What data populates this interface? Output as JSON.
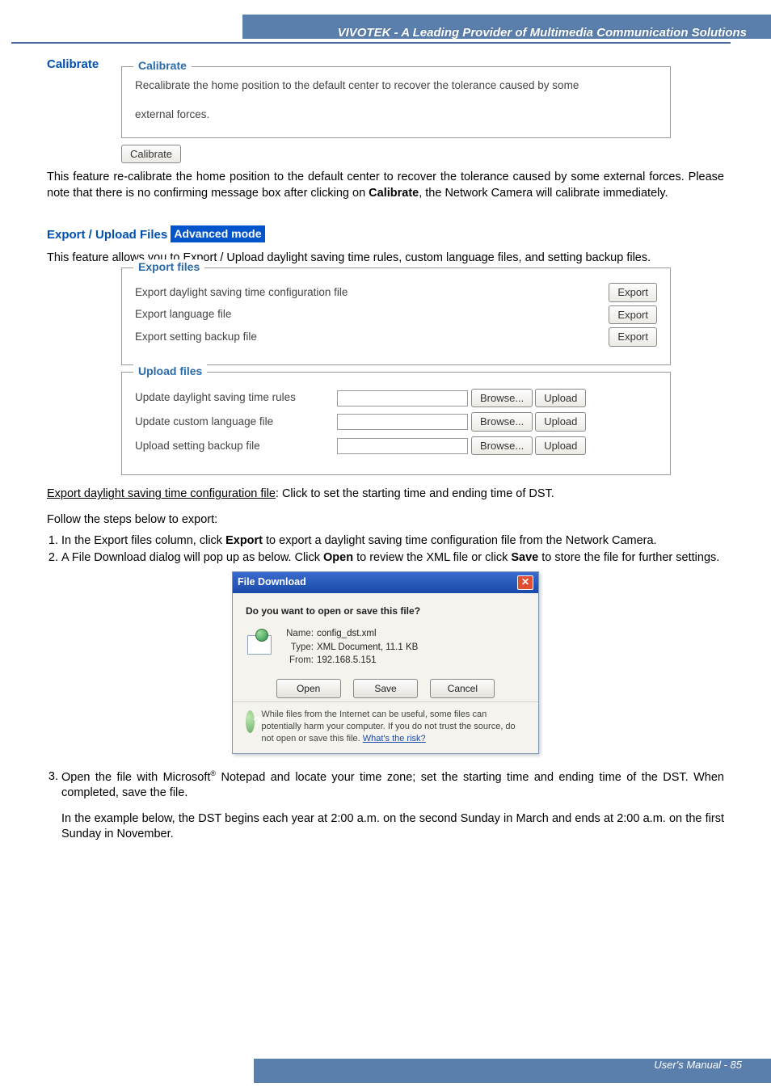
{
  "header": {
    "brand_line": "VIVOTEK - A Leading Provider of Multimedia Communication Solutions"
  },
  "calibrate": {
    "title": "Calibrate",
    "fieldset_legend": "Calibrate",
    "fieldset_line1": "Recalibrate the home position to the default center to recover the tolerance caused by some",
    "fieldset_line2": "external forces.",
    "button": "Calibrate",
    "body": "This feature re-calibrate the home position to the default center to recover the tolerance caused by some external forces. Please note that there is no confirming message box after clicking on Calibrate, the Network Camera will calibrate immediately.",
    "body_prefix": "This feature re-calibrate the home position to the default center to recover the tolerance caused by some external forces. Please note that there is no confirming message box after clicking on ",
    "body_bold": "Calibrate",
    "body_suffix": ", the Network Camera will calibrate immediately."
  },
  "export_upload": {
    "title": "Export / Upload Files",
    "badge": "Advanced mode",
    "intro": "This feature allows you to Export / Upload daylight saving time rules, custom language files, and setting backup files.",
    "export_legend": "Export files",
    "export_rows": [
      "Export daylight saving time configuration file",
      "Export language file",
      "Export setting backup file"
    ],
    "export_btn": "Export",
    "upload_legend": "Upload files",
    "upload_rows": [
      "Update daylight saving time rules",
      "Update custom language file",
      "Upload setting backup file"
    ],
    "browse_btn": "Browse...",
    "upload_btn": "Upload",
    "explain_heading": "Export daylight saving time configuration file",
    "explain_suffix": ": Click to set the starting time and ending time of DST.",
    "follow_steps": "Follow the steps below to export:",
    "step1_prefix": "In the Export files column, click ",
    "step1_bold": "Export",
    "step1_suffix": " to export a daylight saving time configuration file from the Network Camera.",
    "step2_prefix": "A File Download dialog will pop up as below. Click ",
    "step2_bold1": "Open",
    "step2_mid": " to review the XML file or click ",
    "step2_bold2": "Save",
    "step2_suffix": " to store the file for further settings."
  },
  "file_dialog": {
    "title": "File Download",
    "question": "Do you want to open or save this file?",
    "name_label": "Name:",
    "name_value": "config_dst.xml",
    "type_label": "Type:",
    "type_value": "XML Document, 11.1 KB",
    "from_label": "From:",
    "from_value": "192.168.5.151",
    "open_btn": "Open",
    "save_btn": "Save",
    "cancel_btn": "Cancel",
    "warn_text": "While files from the Internet can be useful, some files can potentially harm your computer. If you do not trust the source, do not open or save this file. ",
    "warn_link": "What's the risk?"
  },
  "step3": {
    "prefix": "Open the file with Microsoft",
    "reg": "®",
    "suffix": " Notepad and locate your time zone; set the starting time and ending time of the DST. When completed, save the file."
  },
  "example_para": "In the example below, the DST begins each year at 2:00 a.m. on the second Sunday in March and ends at 2:00 a.m. on the first Sunday in November.",
  "footer": {
    "text": "User's Manual - 85"
  }
}
